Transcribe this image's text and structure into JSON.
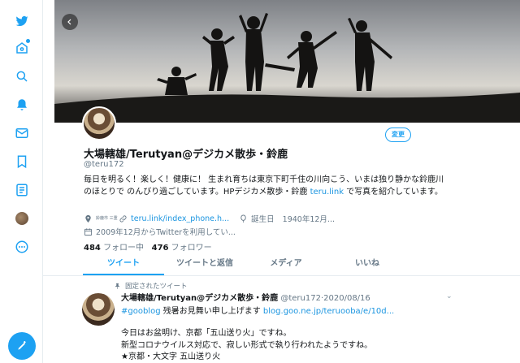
{
  "nav": {
    "items": [
      "twitter-logo",
      "home",
      "explore",
      "notifications",
      "messages",
      "bookmarks",
      "lists",
      "profile",
      "more"
    ],
    "accent": "#1da1f2"
  },
  "profile": {
    "edit_label": "変更",
    "display_name": "大場轄雄/Terutyan@デジカメ散歩・鈴鹿",
    "handle": "@teru172",
    "bio_text": "毎日を明るく！楽しく！健康に！ 生まれ育ちは東京下町千住の川向こう、いまは独り静かな鈴鹿川のほとりで のんびり過ごしています。HPデジカメ散歩・鈴鹿 ",
    "bio_link": "teru.link",
    "bio_tail": " で写真を紹介しています。",
    "location_label": "鈴鹿市\n三重",
    "website": "teru.link/index_phone.h...",
    "birthday_label": "誕生日",
    "birthday_value": "1940年12月...",
    "joined": "2009年12月からTwitterを利用してい...",
    "following_count": "484",
    "following_label": "フォロー中",
    "followers_count": "476",
    "followers_label": "フォロワー"
  },
  "tabs": [
    "ツイート",
    "ツイートと返信",
    "メディア",
    "いいね"
  ],
  "pinned_tweet": {
    "pinned_label": "固定されたツイート",
    "name": "大場轄雄/Terutyan@デジカメ散歩・鈴鹿",
    "meta": "@teru172·2020/08/16",
    "hashtag": "#gooblog",
    "line_text": " 残暑お見舞い申し上げます ",
    "line_link": "blog.goo.ne.jp/teruooba/e/10d...",
    "body": [
      "今日はお盆明け、京都「五山送り火」ですね。",
      "新型コロナウイルス対応で、寂しい形式で執り行われたようですね。",
      "★京都・大文字 五山送り火"
    ]
  }
}
